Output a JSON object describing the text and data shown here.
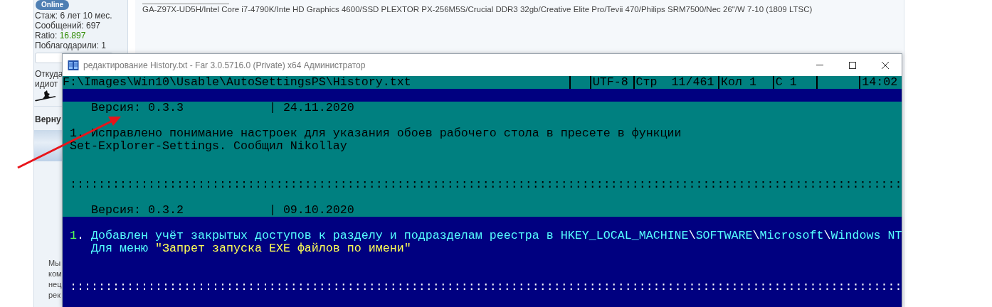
{
  "forum": {
    "status_badge": "Online",
    "stats": [
      {
        "label": "Стаж:",
        "value": "6 лет 10 мес.",
        "color": "#333333"
      },
      {
        "label": "Сообщений:",
        "value": "697",
        "color": "#333333"
      },
      {
        "label": "Ratio:",
        "value": "16.897",
        "color": "#2e8b00"
      },
      {
        "label": "Поблагодарили:",
        "value": "1",
        "color": "#333333"
      }
    ],
    "location_lines": [
      "Откуда",
      "идиот"
    ],
    "back_link": "Верну",
    "notice_lines": [
      "Мы",
      "ком",
      "нец",
      "рек"
    ],
    "signature": "GA-Z97X-UD5H/Intel Core i7-4790K/Inte HD Graphics 4600/SSD PLEXTOR PX-256M5S/Crucial DDR3 32gb/Creative Elite Pro/Tevii 470/Philips SRM7500/Nec 26\"/W 7-10 (1809 LTSC)"
  },
  "window": {
    "title": "редактирование History.txt - Far 3.0.5716.0 (Private) x64 Администратор",
    "status_bar": {
      "path": "F:\\Images\\Win10\\Usable\\AutoSettingsPS\\History.txt",
      "encoding": "UTF-8",
      "line": "Стр  11/461",
      "column": "Кол 1",
      "char": "С 1",
      "clock": "14:02"
    },
    "blocks": [
      {
        "color": "#000080",
        "lines": [
          {
            "kind": "blank"
          }
        ]
      },
      {
        "color": "#008080",
        "lines": [
          {
            "kind": "heading",
            "segments": [
              {
                "text": "Версия: 0.3.3            | 24.11.2020",
                "color": "#000000"
              }
            ]
          },
          {
            "kind": "blank"
          },
          {
            "kind": "item",
            "segments": [
              {
                "text": "1. Исправлено понимание настроек для указания обоев рабочего стола в пресете в функции",
                "color": "#000000"
              }
            ]
          },
          {
            "kind": "item",
            "segments": [
              {
                "text": "Set-Explorer-Settings. Сообщил Nikollay",
                "color": "#000000"
              }
            ]
          },
          {
            "kind": "blank"
          },
          {
            "kind": "blank"
          },
          {
            "kind": "rule",
            "segments": [
              {
                "text": ":::::::::::::::::::::::::::::::::::::::::::::::::::::::::::::::::::::::::::::::::::::::::::::::::::::::::::::::::::::",
                "color": "#000000"
              }
            ]
          },
          {
            "kind": "blank"
          },
          {
            "kind": "heading",
            "segments": [
              {
                "text": "Версия: 0.3.2            | 09.10.2020",
                "color": "#000000"
              }
            ]
          }
        ]
      },
      {
        "color": "#000080",
        "lines": [
          {
            "kind": "blank"
          },
          {
            "kind": "item",
            "segments": [
              {
                "text": "1",
                "color": "#55ff55"
              },
              {
                "text": ". ",
                "color": "#ffffff"
              },
              {
                "text": "Добавлен учёт закрытых доступов к разделу и подразделам реестра в HKEY_LOCAL_MACHINE",
                "color": "#55ffff"
              },
              {
                "text": "\\",
                "color": "#ffffff"
              },
              {
                "text": "SOFTWARE",
                "color": "#55ffff"
              },
              {
                "text": "\\",
                "color": "#ffffff"
              },
              {
                "text": "Microsoft",
                "color": "#55ffff"
              },
              {
                "text": "\\",
                "color": "#ffffff"
              },
              {
                "text": "Windows NT",
                "color": "#55ffff"
              }
            ]
          },
          {
            "kind": "note",
            "segments": [
              {
                "text": "Для меню ",
                "color": "#55ffff"
              },
              {
                "text": "\"Запрет запуска EXE файлов по имени\"",
                "color": "#ffff55"
              }
            ]
          },
          {
            "kind": "blank"
          },
          {
            "kind": "blank"
          },
          {
            "kind": "rule",
            "segments": [
              {
                "text": ":::::::::::::::::::::::::::::::::::::::::::::::::::::::::::::::::::::::::::::::::::::::::::::::::::::::::::::::::::::",
                "color": "#ffffff"
              }
            ]
          },
          {
            "kind": "blank"
          },
          {
            "kind": "blank"
          }
        ]
      }
    ]
  }
}
